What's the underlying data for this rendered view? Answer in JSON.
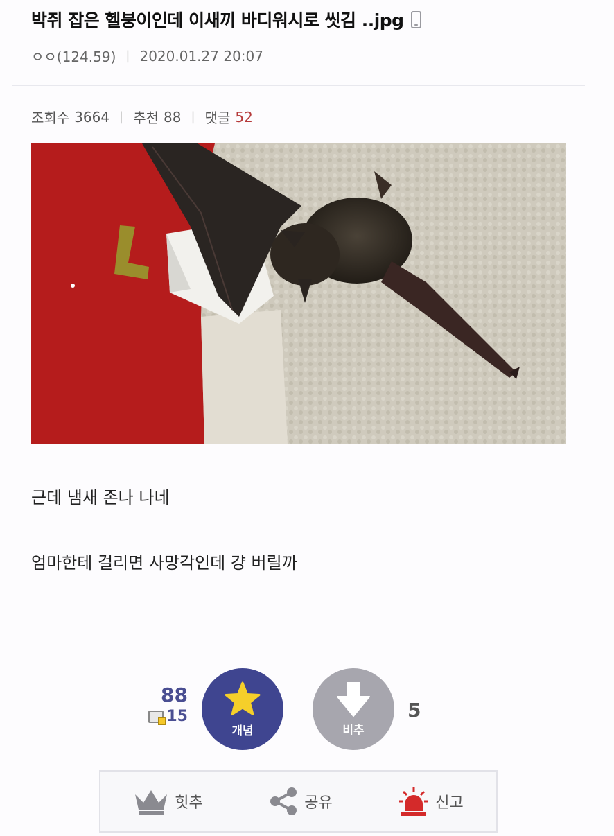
{
  "post": {
    "title": "박쥐 잡은 헬붕이인데 이새끼 바디워시로 씻김 ..jpg",
    "author": "ㅇㅇ(124.59)",
    "date": "2020.01.27 20:07"
  },
  "stats": {
    "views_label": "조회수",
    "views": "3664",
    "recommend_label": "추천",
    "recommend": "88",
    "comments_label": "댓글",
    "comments": "52"
  },
  "content": {
    "line1": "근데 냄새 존나 나네",
    "line2": "엄마한테 걸리면 사망각인데 걍 버릴까"
  },
  "vote": {
    "up_count": "88",
    "fixed_count": "15",
    "up_label": "개념",
    "down_label": "비추",
    "down_count": "5"
  },
  "actions": {
    "hit_label": "힛추",
    "share_label": "공유",
    "report_label": "신고"
  },
  "colors": {
    "accent": "#3f4590",
    "comment_count": "#b53a3a",
    "downvote": "#a7a6ae"
  },
  "icons": [
    "mobile-icon",
    "star-icon",
    "down-arrow-icon",
    "crown-icon",
    "share-icon",
    "siren-icon"
  ]
}
